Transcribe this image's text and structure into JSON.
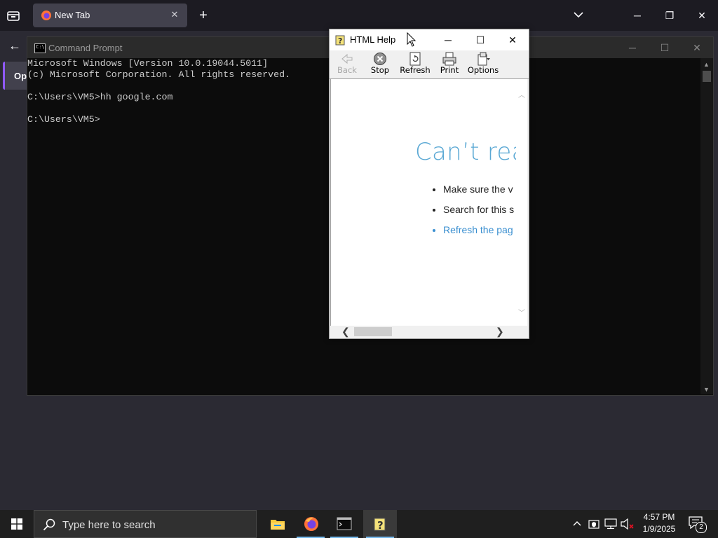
{
  "firefox": {
    "tab_title": "New Tab",
    "open_button_label": "Ope"
  },
  "cmd": {
    "title": "Command Prompt",
    "lines": [
      "Microsoft Windows [Version 10.0.19044.5011]",
      "(c) Microsoft Corporation. All rights reserved.",
      "",
      "C:\\Users\\VM5>hh google.com",
      "",
      "C:\\Users\\VM5>"
    ]
  },
  "html_help": {
    "title": "HTML Help",
    "toolbar": {
      "back": "Back",
      "stop": "Stop",
      "refresh": "Refresh",
      "print": "Print",
      "options": "Options"
    },
    "error_title": "Can’t reac",
    "items": [
      "Make sure the v",
      "Search for this s",
      "Refresh the pag"
    ]
  },
  "taskbar": {
    "search_placeholder": "Type here to search",
    "time": "4:57 PM",
    "date": "1/9/2025",
    "notification_count": "2"
  },
  "colors": {
    "accent": "#76b9ed",
    "link": "#3a8fd0",
    "error_title": "#5aa8d4"
  }
}
